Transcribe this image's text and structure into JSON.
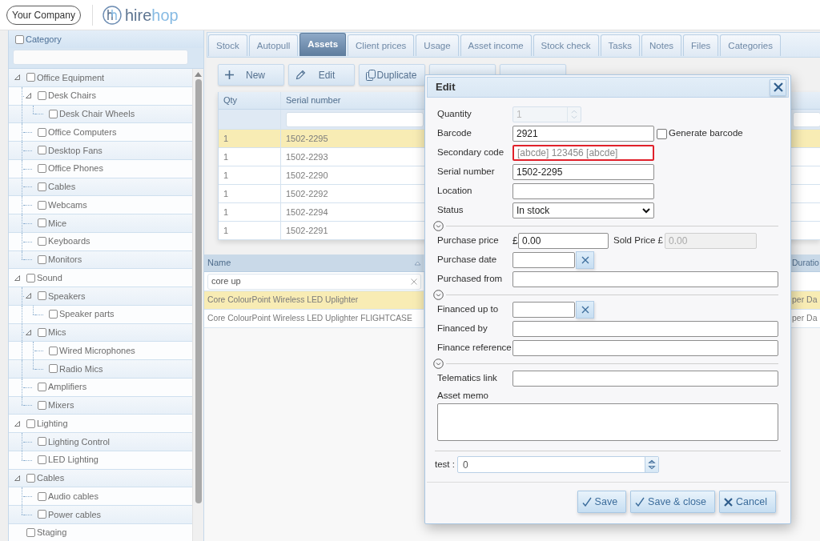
{
  "header": {
    "company_button": "Your Company",
    "logo": [
      "hire",
      "hop"
    ]
  },
  "category_panel": {
    "title": "Category",
    "checked": false,
    "tree": [
      {
        "label": "Office Equipment",
        "checked": false,
        "expanded": true,
        "children": [
          {
            "label": "Desk Chairs",
            "checked": false,
            "expanded": true,
            "children": [
              {
                "label": "Desk Chair Wheels",
                "checked": false
              }
            ]
          },
          {
            "label": "Office Computers",
            "checked": false
          },
          {
            "label": "Desktop Fans",
            "checked": false
          },
          {
            "label": "Office Phones",
            "checked": false
          },
          {
            "label": "Cables",
            "checked": false
          },
          {
            "label": "Webcams",
            "checked": false
          },
          {
            "label": "Mice",
            "checked": false
          },
          {
            "label": "Keyboards",
            "checked": false
          },
          {
            "label": "Monitors",
            "checked": false
          }
        ]
      },
      {
        "label": "Sound",
        "checked": false,
        "expanded": true,
        "children": [
          {
            "label": "Speakers",
            "checked": false,
            "expanded": true,
            "children": [
              {
                "label": "Speaker parts",
                "checked": false
              }
            ]
          },
          {
            "label": "Mics",
            "checked": false,
            "expanded": true,
            "children": [
              {
                "label": "Wired Microphones",
                "checked": false
              },
              {
                "label": "Radio Mics",
                "checked": false
              }
            ]
          },
          {
            "label": "Amplifiers",
            "checked": false
          },
          {
            "label": "Mixers",
            "checked": false
          }
        ]
      },
      {
        "label": "Lighting",
        "checked": false,
        "expanded": true,
        "children": [
          {
            "label": "Lighting Control",
            "checked": false
          },
          {
            "label": "LED Lighting",
            "checked": false
          }
        ]
      },
      {
        "label": "Cables",
        "checked": false,
        "expanded": true,
        "children": [
          {
            "label": "Audio cables",
            "checked": false
          },
          {
            "label": "Power cables",
            "checked": false
          }
        ]
      },
      {
        "label": "Staging",
        "checked": false
      }
    ]
  },
  "tabs": [
    {
      "label": "Stock",
      "selected": false
    },
    {
      "label": "Autopull",
      "selected": false
    },
    {
      "label": "Assets",
      "selected": true
    },
    {
      "label": "Client prices",
      "selected": false
    },
    {
      "label": "Usage",
      "selected": false
    },
    {
      "label": "Asset income",
      "selected": false
    },
    {
      "label": "Stock check",
      "selected": false
    },
    {
      "label": "Tasks",
      "selected": false
    },
    {
      "label": "Notes",
      "selected": false
    },
    {
      "label": "Files",
      "selected": false
    },
    {
      "label": "Categories",
      "selected": false
    }
  ],
  "toolbar": [
    {
      "kind": "plus",
      "label": "New"
    },
    {
      "kind": "pencil",
      "label": "Edit"
    },
    {
      "kind": "copy",
      "label": "Duplicate"
    },
    {
      "kind": "covered"
    },
    {
      "kind": "covered"
    }
  ],
  "assets_table": {
    "columns": [
      "Qty",
      "Serial number"
    ],
    "rows": [
      {
        "cells": [
          "1",
          "1502-2295"
        ],
        "selected": true
      },
      {
        "cells": [
          "1",
          "1502-2293"
        ],
        "selected": false
      },
      {
        "cells": [
          "1",
          "1502-2290"
        ],
        "selected": false
      },
      {
        "cells": [
          "1",
          "1502-2292"
        ],
        "selected": false
      },
      {
        "cells": [
          "1",
          "1502-2294"
        ],
        "selected": false
      },
      {
        "cells": [
          "1",
          "1502-2291"
        ],
        "selected": false
      }
    ]
  },
  "products_grid": {
    "columns": [
      "Name",
      "Duratio"
    ],
    "search": {
      "value": "core up"
    },
    "rows": [
      {
        "cells": [
          "Core ColourPoint Wireless LED Uplighter",
          "per Da"
        ],
        "selected": true
      },
      {
        "cells": [
          "Core ColourPoint Wireless LED Uplighter FLIGHTCASE",
          "per Da"
        ],
        "selected": false
      }
    ]
  },
  "edit_dialog": {
    "title": "Edit",
    "fields": [
      {
        "kind": "spinner",
        "label": "Quantity",
        "value": "1",
        "disabled": true,
        "highlighted": false
      },
      {
        "kind": "text",
        "label": "Barcode",
        "value": "2921",
        "disabled": false,
        "highlighted": false,
        "checkbox": {
          "label": "Generate barcode",
          "checked": false
        }
      },
      {
        "kind": "text",
        "label": "Secondary code",
        "placeholder": "[abcde] 123456 [abcde]",
        "disabled": false,
        "highlighted": true
      },
      {
        "kind": "text",
        "label": "Serial number",
        "value": "1502-2295",
        "disabled": false,
        "highlighted": false
      },
      {
        "kind": "text",
        "label": "Location",
        "disabled": false,
        "highlighted": false
      },
      {
        "kind": "select",
        "label": "Status",
        "value": "In stock",
        "disabled": false,
        "highlighted": false
      },
      {
        "kind": "divider"
      },
      {
        "kind": "price",
        "label": "Purchase price",
        "currency": "£",
        "value": "0.00",
        "disabled": false,
        "highlighted": false,
        "sold": {
          "label": "Sold Price £",
          "value": "0.00",
          "disabled": true
        }
      },
      {
        "kind": "date",
        "label": "Purchase date",
        "disabled": false,
        "highlighted": false
      },
      {
        "kind": "wide",
        "label": "Purchased from",
        "disabled": false,
        "highlighted": false
      },
      {
        "kind": "divider"
      },
      {
        "kind": "date",
        "label": "Financed up to",
        "disabled": false,
        "highlighted": false
      },
      {
        "kind": "wide",
        "label": "Financed by",
        "disabled": false,
        "highlighted": false
      },
      {
        "kind": "wide",
        "label": "Finance reference",
        "disabled": false,
        "highlighted": false
      },
      {
        "kind": "divider"
      },
      {
        "kind": "wide",
        "label": "Telematics link",
        "disabled": false,
        "highlighted": false
      },
      {
        "kind": "memo",
        "label": "Asset memo",
        "disabled": false,
        "highlighted": false
      }
    ],
    "custom_fields": [
      {
        "label": "test :",
        "value": "0"
      }
    ],
    "buttons": [
      {
        "kind": "check",
        "label": "Save"
      },
      {
        "kind": "check",
        "label": "Save & close"
      },
      {
        "kind": "cross",
        "label": "Cancel"
      }
    ]
  }
}
